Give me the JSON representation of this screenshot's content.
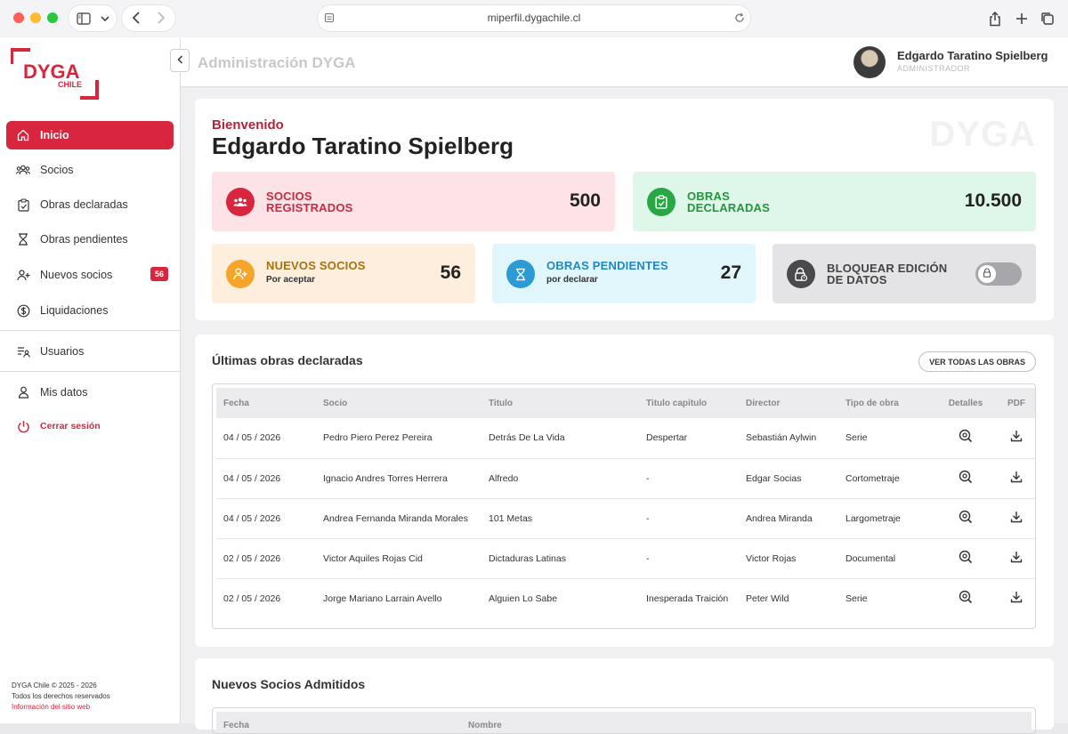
{
  "browser": {
    "url": "miperfil.dygachile.cl"
  },
  "logo": {
    "main": "DYGA",
    "sub": "CHILE",
    "color": "#d7263d"
  },
  "sidebar": {
    "items": [
      {
        "label": "Inicio",
        "icon": "home-icon",
        "active": true
      },
      {
        "label": "Socios",
        "icon": "users-icon"
      },
      {
        "label": "Obras declaradas",
        "icon": "clipboard-icon"
      },
      {
        "label": "Obras pendientes",
        "icon": "hourglass-icon"
      },
      {
        "label": "Nuevos socios",
        "icon": "user-plus-icon",
        "badge": "56"
      },
      {
        "label": "Liquidaciones",
        "icon": "dollar-icon"
      },
      {
        "label": "Usuarios",
        "icon": "user-list-icon"
      },
      {
        "label": "Mis datos",
        "icon": "person-icon"
      },
      {
        "label": "Cerrar sesión",
        "icon": "power-icon"
      }
    ],
    "footer": {
      "copyright": "DYGA Chile © 2025 - 2026",
      "rights": "Todos los derechos reservados",
      "link": "Información del sitio web"
    }
  },
  "header": {
    "title": "Administración DYGA",
    "user_name": "Edgardo Taratino Spielberg",
    "user_role": "ADMINISTRADOR"
  },
  "welcome": {
    "label": "Bienvenido",
    "name": "Edgardo Taratino Spielberg",
    "watermark": "DYGA"
  },
  "stats": {
    "socios": {
      "label1": "SOCIOS",
      "label2": "REGISTRADOS",
      "value": "500",
      "color": "#d7263d"
    },
    "obras": {
      "label1": "OBRAS",
      "label2": "DECLARADAS",
      "value": "10.500",
      "color": "#27a844"
    },
    "nuevos": {
      "label": "NUEVOS SOCIOS",
      "sub": "Por aceptar",
      "value": "56",
      "color": "#f4a52a"
    },
    "pendientes": {
      "label": "OBRAS PENDIENTES",
      "sub": "por declarar",
      "value": "27",
      "color": "#2b9bd6"
    },
    "bloquear": {
      "label1": "BLOQUEAR EDICIÓN",
      "label2": "DE DATOS",
      "color": "#4a4a4c",
      "enabled": false
    }
  },
  "obras_section": {
    "title": "Últimas obras declaradas",
    "button": "VER TODAS LAS OBRAS",
    "columns": [
      "Fecha",
      "Socio",
      "Titulo",
      "Titulo capítulo",
      "Director",
      "Tipo de obra",
      "Detalles",
      "PDF"
    ],
    "rows": [
      {
        "fecha": "04 / 05 / 2026",
        "socio": "Pedro Piero Perez Pereira",
        "titulo": "Detrás De La Vida",
        "capitulo": "Despertar",
        "director": "Sebastián Aylwin",
        "tipo": "Serie"
      },
      {
        "fecha": "04 / 05 / 2026",
        "socio": "Ignacio Andres Torres Herrera",
        "titulo": "Alfredo",
        "capitulo": "-",
        "director": "Edgar Socias",
        "tipo": "Cortometraje"
      },
      {
        "fecha": "04 / 05 / 2026",
        "socio": "Andrea Fernanda Miranda Morales",
        "titulo": "101 Metas",
        "capitulo": "-",
        "director": "Andrea Miranda",
        "tipo": "Largometraje"
      },
      {
        "fecha": "02 / 05 / 2026",
        "socio": "Victor Aquiles Rojas Cid",
        "titulo": "Dictaduras Latinas",
        "capitulo": "-",
        "director": "Victor Rojas",
        "tipo": "Documental"
      },
      {
        "fecha": "02 / 05 / 2026",
        "socio": "Jorge Mariano Larrain Avello",
        "titulo": "Alguien Lo Sabe",
        "capitulo": "Inesperada Traición",
        "director": "Peter Wild",
        "tipo": "Serie"
      }
    ]
  },
  "nuevos_section": {
    "title": "Nuevos Socios Admitidos",
    "columns": [
      "Fecha",
      "Nombre"
    ]
  }
}
